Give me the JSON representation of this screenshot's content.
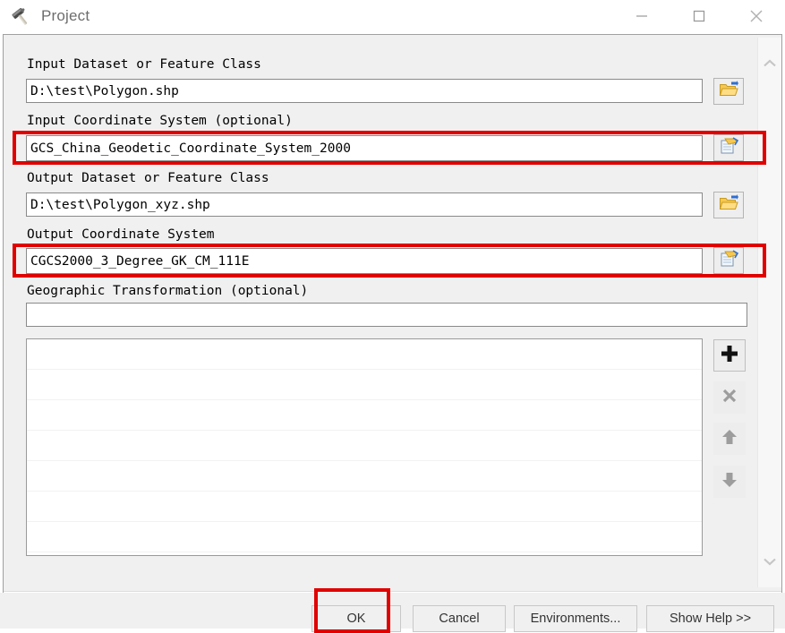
{
  "window": {
    "title": "Project",
    "title_icon": "hammer-icon",
    "controls": {
      "minimize": "minimize-icon",
      "maximize": "maximize-icon",
      "close": "close-icon"
    }
  },
  "form": {
    "fields": [
      {
        "label": "Input Dataset or Feature Class",
        "value": "D:\\test\\Polygon.shp",
        "placeholder": "",
        "browse_icon": "open-folder-icon",
        "highlighted": false
      },
      {
        "label": "Input Coordinate System (optional)",
        "value": "GCS_China_Geodetic_Coordinate_System_2000",
        "placeholder": "",
        "browse_icon": "coordinate-system-icon",
        "highlighted": true
      },
      {
        "label": "Output Dataset or Feature Class",
        "value": "D:\\test\\Polygon_xyz.shp",
        "placeholder": "",
        "browse_icon": "open-folder-icon",
        "highlighted": false
      },
      {
        "label": "Output Coordinate System",
        "value": "CGCS2000_3_Degree_GK_CM_111E",
        "placeholder": "",
        "browse_icon": "coordinate-system-icon",
        "highlighted": true
      },
      {
        "label": "Geographic Transformation (optional)",
        "value": "",
        "placeholder": "",
        "browse_icon": "",
        "highlighted": false
      }
    ],
    "transformation_list": {
      "rows": [],
      "row_count": 7
    },
    "list_tools": [
      {
        "name": "add-button",
        "icon": "plus-icon",
        "enabled": true
      },
      {
        "name": "remove-button",
        "icon": "close-x-icon",
        "enabled": false
      },
      {
        "name": "move-up-button",
        "icon": "arrow-up-icon",
        "enabled": false
      },
      {
        "name": "move-down-button",
        "icon": "arrow-down-icon",
        "enabled": false
      }
    ]
  },
  "scrollbar": {
    "up_icon": "chevron-up-icon",
    "down_icon": "chevron-down-icon"
  },
  "footer": {
    "buttons": [
      {
        "label": "OK",
        "name": "ok-button",
        "highlighted": true
      },
      {
        "label": "Cancel",
        "name": "cancel-button",
        "highlighted": false
      },
      {
        "label": "Environments...",
        "name": "environments-button",
        "highlighted": false
      },
      {
        "label": "Show Help >>",
        "name": "show-help-button",
        "highlighted": false
      }
    ]
  },
  "annotation": {
    "color": "#e00000"
  }
}
